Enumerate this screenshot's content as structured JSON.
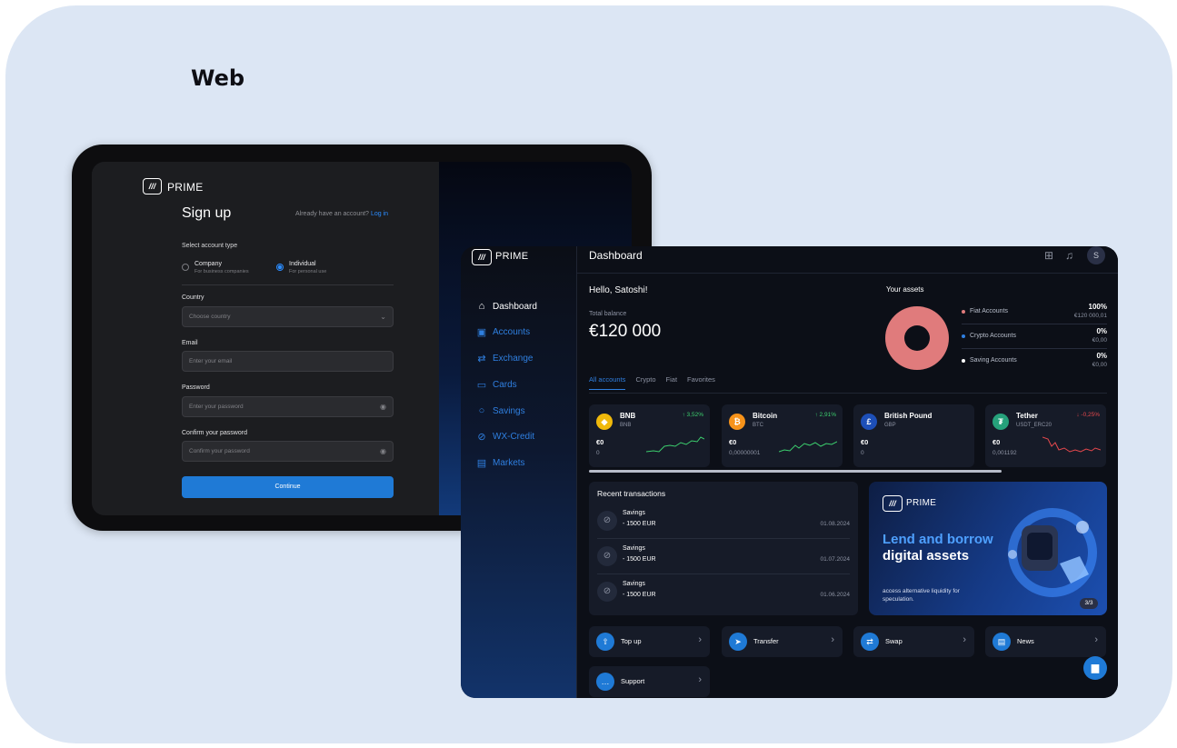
{
  "heading": "Web",
  "signup": {
    "brand": "PRIME",
    "title": "Sign up",
    "already_text": "Already have an account?",
    "login_link": "Log in",
    "account_type_label": "Select account type",
    "account_types": [
      {
        "title": "Company",
        "subtitle": "For business companies",
        "selected": false
      },
      {
        "title": "Individual",
        "subtitle": "For personal use",
        "selected": true
      }
    ],
    "country": {
      "label": "Country",
      "placeholder": "Choose country"
    },
    "email": {
      "label": "Email",
      "placeholder": "Enter your email"
    },
    "password": {
      "label": "Password",
      "placeholder": "Enter your password"
    },
    "confirm_password": {
      "label": "Confirm your password",
      "placeholder": "Confirm your password"
    },
    "continue_label": "Continue"
  },
  "dashboard": {
    "brand": "PRIME",
    "title": "Dashboard",
    "nav": [
      "Dashboard",
      "Accounts",
      "Exchange",
      "Cards",
      "Savings",
      "WX-Credit",
      "Markets"
    ],
    "avatar_initial": "S",
    "greeting": "Hello, Satoshi!",
    "total_balance_label": "Total balance",
    "total_balance": "€120 000",
    "assets_title": "Your assets",
    "assets": [
      {
        "name": "Fiat Accounts",
        "percent": "100%",
        "amount": "€120 000,01",
        "color": "#e07b7c"
      },
      {
        "name": "Crypto Accounts",
        "percent": "0%",
        "amount": "€0,00",
        "color": "#2f7fe0"
      },
      {
        "name": "Saving Accounts",
        "percent": "0%",
        "amount": "€0,00",
        "color": "#ffffff"
      }
    ],
    "tabs": [
      "All accounts",
      "Crypto",
      "Fiat",
      "Favorites"
    ],
    "cards": [
      {
        "name": "BNB",
        "ticker": "BNB",
        "change": "↑ 3,52%",
        "balance": "€0",
        "amount": "0",
        "coin_color": "#f0b90b",
        "change_color": "#3ccf6e",
        "coin": "◆"
      },
      {
        "name": "Bitcoin",
        "ticker": "BTC",
        "change": "↑ 2,91%",
        "balance": "€0",
        "amount": "0,00000001",
        "coin_color": "#f7931a",
        "change_color": "#3ccf6e",
        "coin": "₿"
      },
      {
        "name": "British Pound",
        "ticker": "GBP",
        "change": "",
        "balance": "€0",
        "amount": "0",
        "coin_color": "#1d4fb8",
        "change_color": "#3ccf6e",
        "coin": "£"
      },
      {
        "name": "Tether",
        "ticker": "USDT_ERC20",
        "change": "↓ -0,25%",
        "balance": "€0",
        "amount": "0,001192",
        "coin_color": "#26a17b",
        "change_color": "#e5484d",
        "coin": "₮"
      }
    ],
    "recent_title": "Recent transactions",
    "transactions": [
      {
        "name": "Savings",
        "amount": "- 1500 EUR",
        "date": "01.08.2024"
      },
      {
        "name": "Savings",
        "amount": "- 1500 EUR",
        "date": "01.07.2024"
      },
      {
        "name": "Savings",
        "amount": "- 1500 EUR",
        "date": "01.06.2024"
      }
    ],
    "promo": {
      "brand": "PRIME",
      "headline_hl": "Lend and borrow",
      "headline_rest": "digital assets",
      "subtitle": "access alternative liquidity for speculation.",
      "page": "3/3"
    },
    "actions": [
      "Top up",
      "Transfer",
      "Swap",
      "News",
      "Support"
    ]
  }
}
